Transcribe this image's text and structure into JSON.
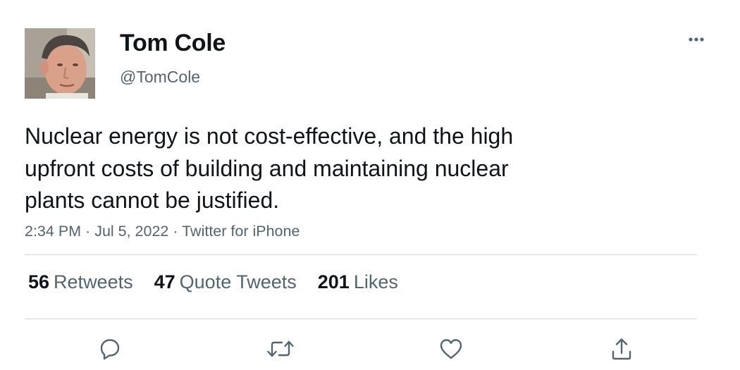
{
  "tweet": {
    "display_name": "Tom Cole",
    "handle": "@TomCole",
    "text_lines": [
      "Nuclear energy is not cost-effective, and the high",
      "upfront costs of building and maintaining nuclear",
      "plants cannot be justified."
    ],
    "time": "2:34 PM",
    "date": "Jul 5, 2022",
    "source": "Twitter for iPhone",
    "separator": " · ",
    "stats": {
      "retweets_count": "56",
      "retweets_label": "Retweets",
      "quotes_count": "47",
      "quotes_label": "Quote Tweets",
      "likes_count": "201",
      "likes_label": "Likes"
    },
    "actions": {
      "reply_icon": "reply-icon",
      "retweet_icon": "retweet-icon",
      "like_icon": "heart-icon",
      "share_icon": "share-icon"
    },
    "more_icon": "more-horizontal-icon"
  },
  "colors": {
    "text_primary": "#0f1419",
    "text_secondary": "#536471",
    "divider": "#cfd9de"
  }
}
